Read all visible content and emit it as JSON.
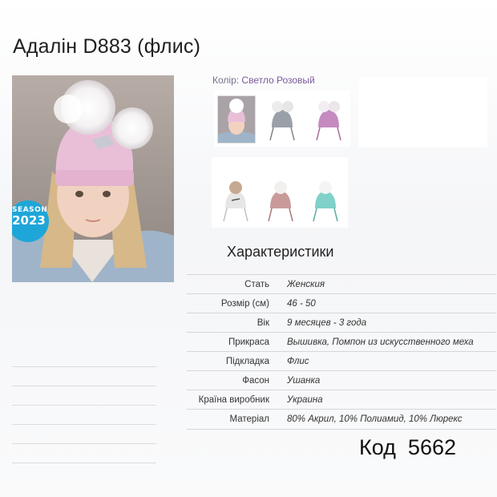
{
  "product": {
    "title": "Адалін D883 (флис)",
    "badge": {
      "line1": "SEASON",
      "line2": "2023"
    }
  },
  "color": {
    "label": "Колір:",
    "value": "Светло Розовый",
    "swatches": [
      {
        "name": "Светло Розовый",
        "accent": "#e9bfd8"
      },
      {
        "name": "Серый",
        "accent": "#9aa0a8"
      },
      {
        "name": "Сиреневый",
        "accent": "#c58bc0"
      },
      {
        "name": "Белый",
        "accent": "#e6e6e6"
      },
      {
        "name": "Пудровый",
        "accent": "#c99a9a"
      },
      {
        "name": "Мятный",
        "accent": "#7fd1c9"
      }
    ]
  },
  "characteristics": {
    "heading": "Характеристики",
    "rows": [
      {
        "key": "Стать",
        "value": "Женския"
      },
      {
        "key": "Розмір (см)",
        "value": "46 - 50"
      },
      {
        "key": "Вік",
        "value": "9 месяцев - 3 года"
      },
      {
        "key": "Прикраса",
        "value": "Вышивка, Помпон из искусственного меха"
      },
      {
        "key": "Підкладка",
        "value": "Флис"
      },
      {
        "key": "Фасон",
        "value": "Ушанка"
      },
      {
        "key": "Країна виробник",
        "value": "Украина"
      },
      {
        "key": "Матеріал",
        "value": "80% Акрил, 10% Полиамид, 10% Люрекс"
      }
    ]
  },
  "code": {
    "label": "Код",
    "value": "5662"
  }
}
